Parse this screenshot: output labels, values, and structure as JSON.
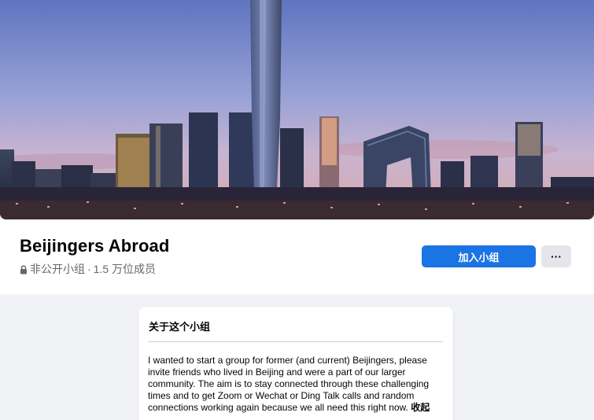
{
  "group": {
    "name": "Beijingers Abroad",
    "privacy": "非公开小组",
    "separator": "·",
    "members": "1.5 万位成员"
  },
  "actions": {
    "join_label": "加入小组",
    "more_label": "···"
  },
  "about": {
    "heading": "关于这个小组",
    "description": "I wanted to start a group for former (and current) Beijingers, please invite friends who lived in Beijing and were a part of our larger community. The aim is to stay connected through these challenging times and to get Zoom or Wechat or Ding Talk calls and random connections working again because we all need this right now.",
    "collapse_label": "收起"
  },
  "colors": {
    "primary": "#1b74e4",
    "page_bg": "#f0f2f5",
    "secondary_text": "#65676b"
  },
  "cover": {
    "alt": "Beijing skyline at dusk"
  }
}
